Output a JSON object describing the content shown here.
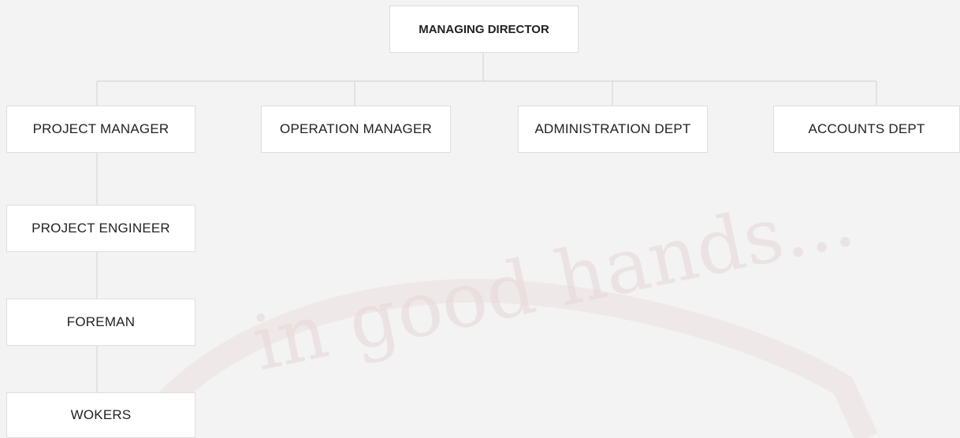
{
  "watermark": {
    "text": "in good hands...",
    "color": "#e7d9d9"
  },
  "colors": {
    "background": "#f3f3f3",
    "node_fill": "#ffffff",
    "node_border": "#dedede",
    "connector": "#d6d6d6"
  },
  "org_chart": {
    "root": "MANAGING DIRECTOR",
    "departments": [
      "PROJECT MANAGER",
      "OPERATION MANAGER",
      "ADMINISTRATION DEPT",
      "ACCOUNTS DEPT"
    ],
    "project_chain": [
      "PROJECT ENGINEER",
      "FOREMAN",
      "WOKERS"
    ]
  }
}
